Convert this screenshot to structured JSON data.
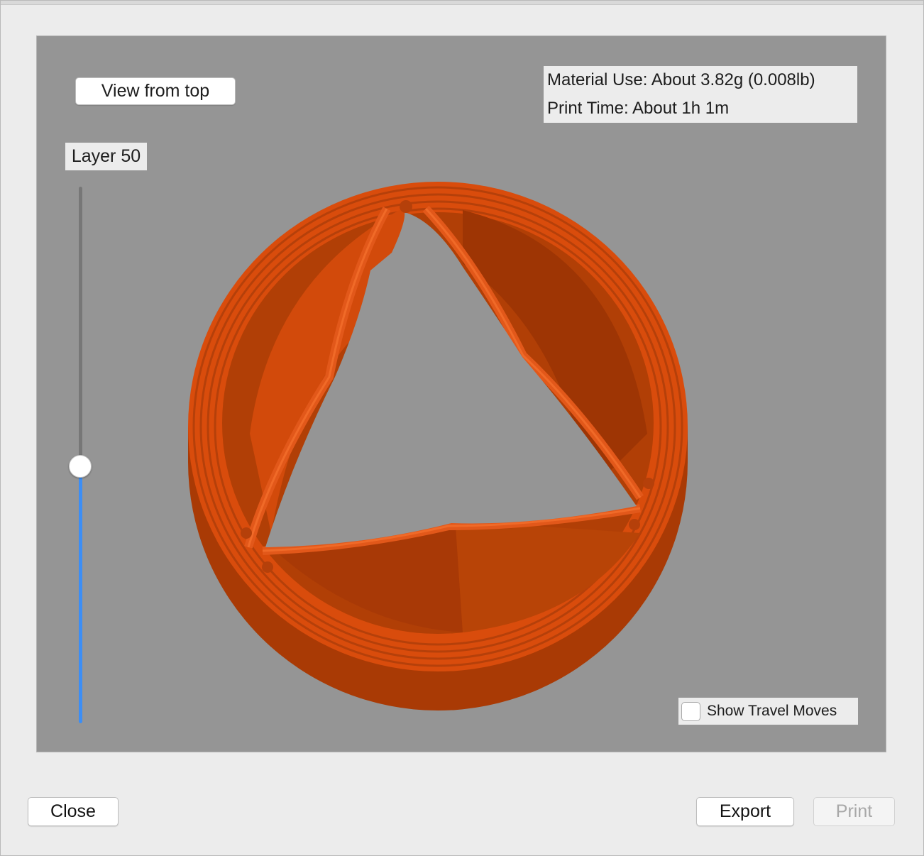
{
  "viewer": {
    "view_from_top_label": "View from top",
    "layer_label": "Layer 50",
    "material_use": "Material Use: About 3.82g (0.008lb)",
    "print_time": "Print Time: About 1h 1m",
    "show_travel_moves_label": "Show Travel Moves",
    "show_travel_moves_checked": false,
    "layer_slider_position": 0.53
  },
  "footer": {
    "close_label": "Close",
    "export_label": "Export",
    "print_label": "Print",
    "print_enabled": false
  },
  "colors": {
    "model_face": "#d94c0c",
    "model_side": "#a93a05",
    "model_edge": "#e56020",
    "viewport_bg": "#959595",
    "slider_fill": "#3c8ef5"
  }
}
